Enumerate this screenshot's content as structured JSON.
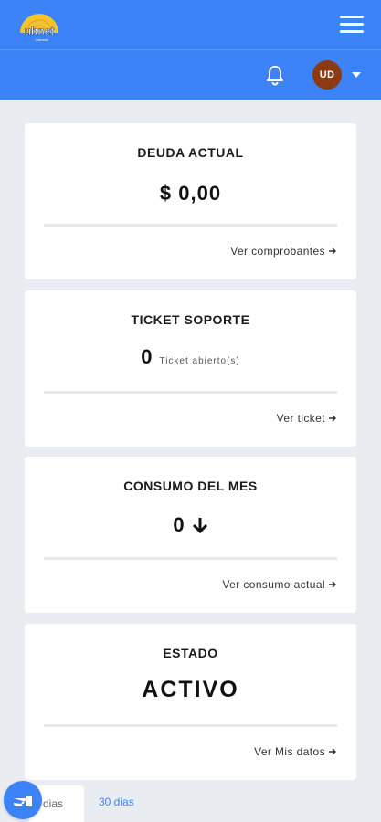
{
  "brand": {
    "logo_text": "ubnet",
    "logo_subtext": "internet"
  },
  "header": {
    "avatar_initials": "UD"
  },
  "cards": [
    {
      "title": "DEUDA ACTUAL",
      "value": "$ 0,00",
      "link": "Ver comprobantes"
    },
    {
      "title": "TICKET SOPORTE",
      "value": "0",
      "value_suffix": "Ticket abierto(s)",
      "link": "Ver ticket"
    },
    {
      "title": "CONSUMO DEL MES",
      "value": "0",
      "trend_icon": "arrow-down-icon",
      "link": "Ver consumo actual"
    },
    {
      "title": "ESTADO",
      "value": "ACTIVO",
      "link": "Ver Mis datos"
    }
  ],
  "tabs": {
    "active_partial": "dias",
    "second": "30 dias"
  },
  "colors": {
    "primary": "#3b83f6",
    "avatar": "#8b3a12",
    "background": "#e9ecf1",
    "logo_yellow": "#f4c430"
  }
}
